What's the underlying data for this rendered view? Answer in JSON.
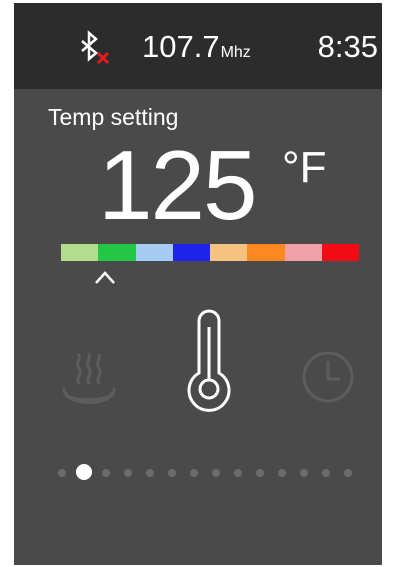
{
  "status_bar": {
    "bluetooth_icon": "bluetooth-disconnected-icon",
    "frequency": "107.7",
    "frequency_unit": "Mhz",
    "time": "8:35"
  },
  "main": {
    "label": "Temp setting",
    "temperature": "125",
    "unit": "°F"
  },
  "color_scale": {
    "colors": [
      "#b3dd8f",
      "#22c845",
      "#a5cdf3",
      "#1f23ee",
      "#f5c37f",
      "#fb8820",
      "#f0a0a6",
      "#f20b14"
    ],
    "marker_icon": "caret-up-icon"
  },
  "mode_icons": {
    "left": "steam-bath-icon",
    "center": "thermometer-icon",
    "right": "clock-icon",
    "selected": "center"
  },
  "pagination": {
    "total": 14,
    "active_index": 1
  }
}
